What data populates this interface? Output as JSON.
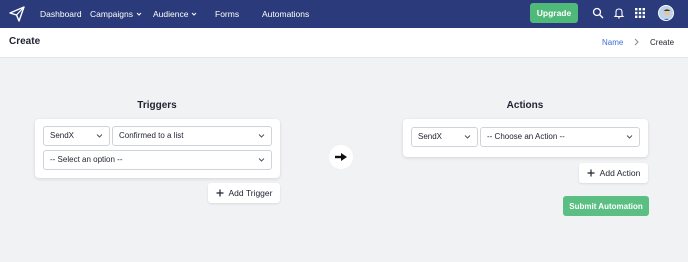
{
  "nav": {
    "items": [
      {
        "label": "Dashboard",
        "has_dropdown": false
      },
      {
        "label": "Campaigns",
        "has_dropdown": true
      },
      {
        "label": "Audience",
        "has_dropdown": true
      },
      {
        "label": "Forms",
        "has_dropdown": false
      },
      {
        "label": "Automations",
        "has_dropdown": false
      }
    ],
    "upgrade_label": "Upgrade",
    "icons": [
      "logo-icon",
      "search-icon",
      "bell-icon",
      "apps-grid-icon",
      "avatar"
    ]
  },
  "header": {
    "title": "Create",
    "breadcrumb": {
      "link": "Name",
      "current": "Create"
    }
  },
  "triggers": {
    "title": "Triggers",
    "source_select": "SendX",
    "event_select": "Confirmed to a list",
    "option_select": "-- Select an option --",
    "add_label": "Add Trigger"
  },
  "actions": {
    "title": "Actions",
    "source_select": "SendX",
    "action_select": "-- Choose an Action --",
    "add_label": "Add Action",
    "submit_label": "Submit Automation"
  },
  "colors": {
    "nav_bg": "#2a3a7a",
    "accent_green": "#4fb97a",
    "link_blue": "#3c6fd8",
    "page_bg": "#f1f2f4"
  }
}
